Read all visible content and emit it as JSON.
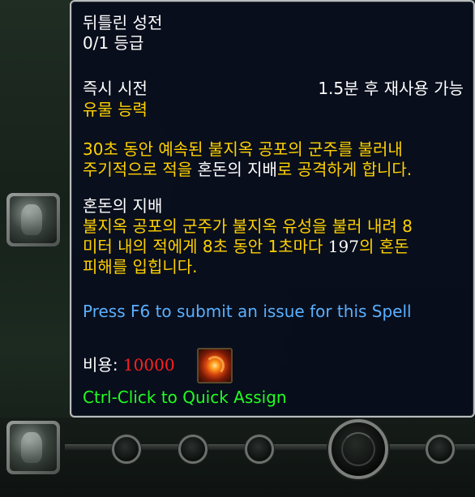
{
  "tooltip": {
    "spell_name": "뒤틀린 성전",
    "rank": "0/1 등급",
    "cast_type": "즉시 시전",
    "cooldown": "1.5분 후 재사용 가능",
    "category": "유물 능력",
    "desc_line1": "30초 동안 예속된 불지옥 공포의 군주를 불러내",
    "desc_line2_pre": "주기적으로 적을 ",
    "desc_line2_white": "혼돈의 지배",
    "desc_line2_post": "로 공격하게 합니다.",
    "sub_title": "혼돈의 지배",
    "sub_line1": "불지옥 공포의 군주가 불지옥 유성을 불러 내려 8",
    "sub_line2_pre": "미터 내의 적에게 8초 동안 1초마다 ",
    "sub_line2_white": "197",
    "sub_line2_post": "의 혼돈",
    "sub_line3": "피해를 입힙니다.",
    "report_hint": "Press F6 to submit an issue for this Spell",
    "cost_label": "비용",
    "cost_colon": ":",
    "cost_value": "10000",
    "quick_assign": "Ctrl-Click to Quick Assign"
  },
  "colors": {
    "white": "#ffffff",
    "gold": "#ffd100",
    "red": "#ff2020",
    "blue": "#5ab0ff",
    "green": "#20ff20",
    "tooltip_bg": "#080e1c"
  },
  "icons": {
    "talent_icon_top": "demon-lord-icon",
    "talent_icon_bottom": "fel-skull-icon",
    "cost_icon": "artifact-power-icon"
  }
}
